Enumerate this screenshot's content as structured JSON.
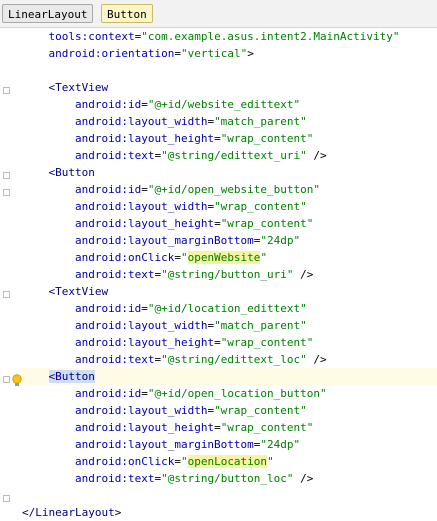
{
  "breadcrumb": [
    {
      "label": "LinearLayout",
      "active": false
    },
    {
      "label": "Button",
      "active": true
    }
  ],
  "code": [
    {
      "indent": 1,
      "parts": [
        [
          "attr",
          "tools:context"
        ],
        [
          "plain",
          "="
        ],
        [
          "val",
          "\"com.example.asus.intent2.MainActivity\""
        ]
      ]
    },
    {
      "indent": 1,
      "parts": [
        [
          "attr",
          "android:orientation"
        ],
        [
          "plain",
          "="
        ],
        [
          "val",
          "\"vertical\""
        ],
        [
          "plain",
          ">"
        ]
      ]
    },
    {
      "indent": 0,
      "parts": []
    },
    {
      "indent": 1,
      "parts": [
        [
          "tag",
          "<TextView"
        ]
      ]
    },
    {
      "indent": 2,
      "parts": [
        [
          "attr",
          "android:id"
        ],
        [
          "plain",
          "="
        ],
        [
          "val",
          "\"@+id/website_edittext\""
        ]
      ]
    },
    {
      "indent": 2,
      "parts": [
        [
          "attr",
          "android:layout_width"
        ],
        [
          "plain",
          "="
        ],
        [
          "val",
          "\"match_parent\""
        ]
      ]
    },
    {
      "indent": 2,
      "parts": [
        [
          "attr",
          "android:layout_height"
        ],
        [
          "plain",
          "="
        ],
        [
          "val",
          "\"wrap_content\""
        ]
      ]
    },
    {
      "indent": 2,
      "parts": [
        [
          "attr",
          "android:text"
        ],
        [
          "plain",
          "="
        ],
        [
          "val",
          "\"@string/edittext_uri\""
        ],
        [
          "plain",
          " />"
        ]
      ]
    },
    {
      "indent": 1,
      "parts": [
        [
          "tag",
          "<Button"
        ]
      ]
    },
    {
      "indent": 2,
      "parts": [
        [
          "attr",
          "android:id"
        ],
        [
          "plain",
          "="
        ],
        [
          "val",
          "\"@+id/open_website_button\""
        ]
      ]
    },
    {
      "indent": 2,
      "parts": [
        [
          "attr",
          "android:layout_width"
        ],
        [
          "plain",
          "="
        ],
        [
          "val",
          "\"wrap_content\""
        ]
      ]
    },
    {
      "indent": 2,
      "parts": [
        [
          "attr",
          "android:layout_height"
        ],
        [
          "plain",
          "="
        ],
        [
          "val",
          "\"wrap_content\""
        ]
      ]
    },
    {
      "indent": 2,
      "parts": [
        [
          "attr",
          "android:layout_marginBottom"
        ],
        [
          "plain",
          "="
        ],
        [
          "val",
          "\"24dp\""
        ]
      ]
    },
    {
      "indent": 2,
      "parts": [
        [
          "attr",
          "android:onClick"
        ],
        [
          "plain",
          "="
        ],
        [
          "val",
          "\""
        ],
        [
          "ref",
          "openWebsite"
        ],
        [
          "val",
          "\""
        ]
      ]
    },
    {
      "indent": 2,
      "parts": [
        [
          "attr",
          "android:text"
        ],
        [
          "plain",
          "="
        ],
        [
          "val",
          "\"@string/button_uri\""
        ],
        [
          "plain",
          " />"
        ]
      ]
    },
    {
      "indent": 1,
      "parts": [
        [
          "tag",
          "<TextView"
        ]
      ]
    },
    {
      "indent": 2,
      "parts": [
        [
          "attr",
          "android:id"
        ],
        [
          "plain",
          "="
        ],
        [
          "val",
          "\"@+id/location_edittext\""
        ]
      ]
    },
    {
      "indent": 2,
      "parts": [
        [
          "attr",
          "android:layout_width"
        ],
        [
          "plain",
          "="
        ],
        [
          "val",
          "\"match_parent\""
        ]
      ]
    },
    {
      "indent": 2,
      "parts": [
        [
          "attr",
          "android:layout_height"
        ],
        [
          "plain",
          "="
        ],
        [
          "val",
          "\"wrap_content\""
        ]
      ]
    },
    {
      "indent": 2,
      "parts": [
        [
          "attr",
          "android:text"
        ],
        [
          "plain",
          "="
        ],
        [
          "val",
          "\"@string/edittext_loc\""
        ],
        [
          "plain",
          " />"
        ]
      ]
    },
    {
      "indent": 1,
      "current": true,
      "parts": [
        [
          "taghl",
          "<Button"
        ]
      ]
    },
    {
      "indent": 2,
      "parts": [
        [
          "attr",
          "android:id"
        ],
        [
          "plain",
          "="
        ],
        [
          "val",
          "\"@+id/open_location_button\""
        ]
      ]
    },
    {
      "indent": 2,
      "parts": [
        [
          "attr",
          "android:layout_width"
        ],
        [
          "plain",
          "="
        ],
        [
          "val",
          "\"wrap_content\""
        ]
      ]
    },
    {
      "indent": 2,
      "parts": [
        [
          "attr",
          "android:layout_height"
        ],
        [
          "plain",
          "="
        ],
        [
          "val",
          "\"wrap_content\""
        ]
      ]
    },
    {
      "indent": 2,
      "parts": [
        [
          "attr",
          "android:layout_marginBottom"
        ],
        [
          "plain",
          "="
        ],
        [
          "val",
          "\"24dp\""
        ]
      ]
    },
    {
      "indent": 2,
      "parts": [
        [
          "attr",
          "android:onClick"
        ],
        [
          "plain",
          "="
        ],
        [
          "val",
          "\""
        ],
        [
          "ref",
          "openLocation"
        ],
        [
          "val",
          "\""
        ]
      ]
    },
    {
      "indent": 2,
      "parts": [
        [
          "attr",
          "android:text"
        ],
        [
          "plain",
          "="
        ],
        [
          "val",
          "\"@string/button_loc\""
        ],
        [
          "plain",
          " />"
        ]
      ]
    },
    {
      "indent": 0,
      "parts": []
    },
    {
      "indent": 0,
      "parts": [
        [
          "tag",
          "</LinearLayout"
        ],
        [
          "plain",
          ">"
        ]
      ]
    }
  ],
  "icons": {
    "fold": "fold-marker-icon",
    "bulb": "lightbulb-intention-icon"
  },
  "colors": {
    "attribute": "#0000b4",
    "value": "#008000",
    "tag": "#000080",
    "reference_highlight": "#f7f4a0",
    "current_line": "#fffbe5"
  }
}
